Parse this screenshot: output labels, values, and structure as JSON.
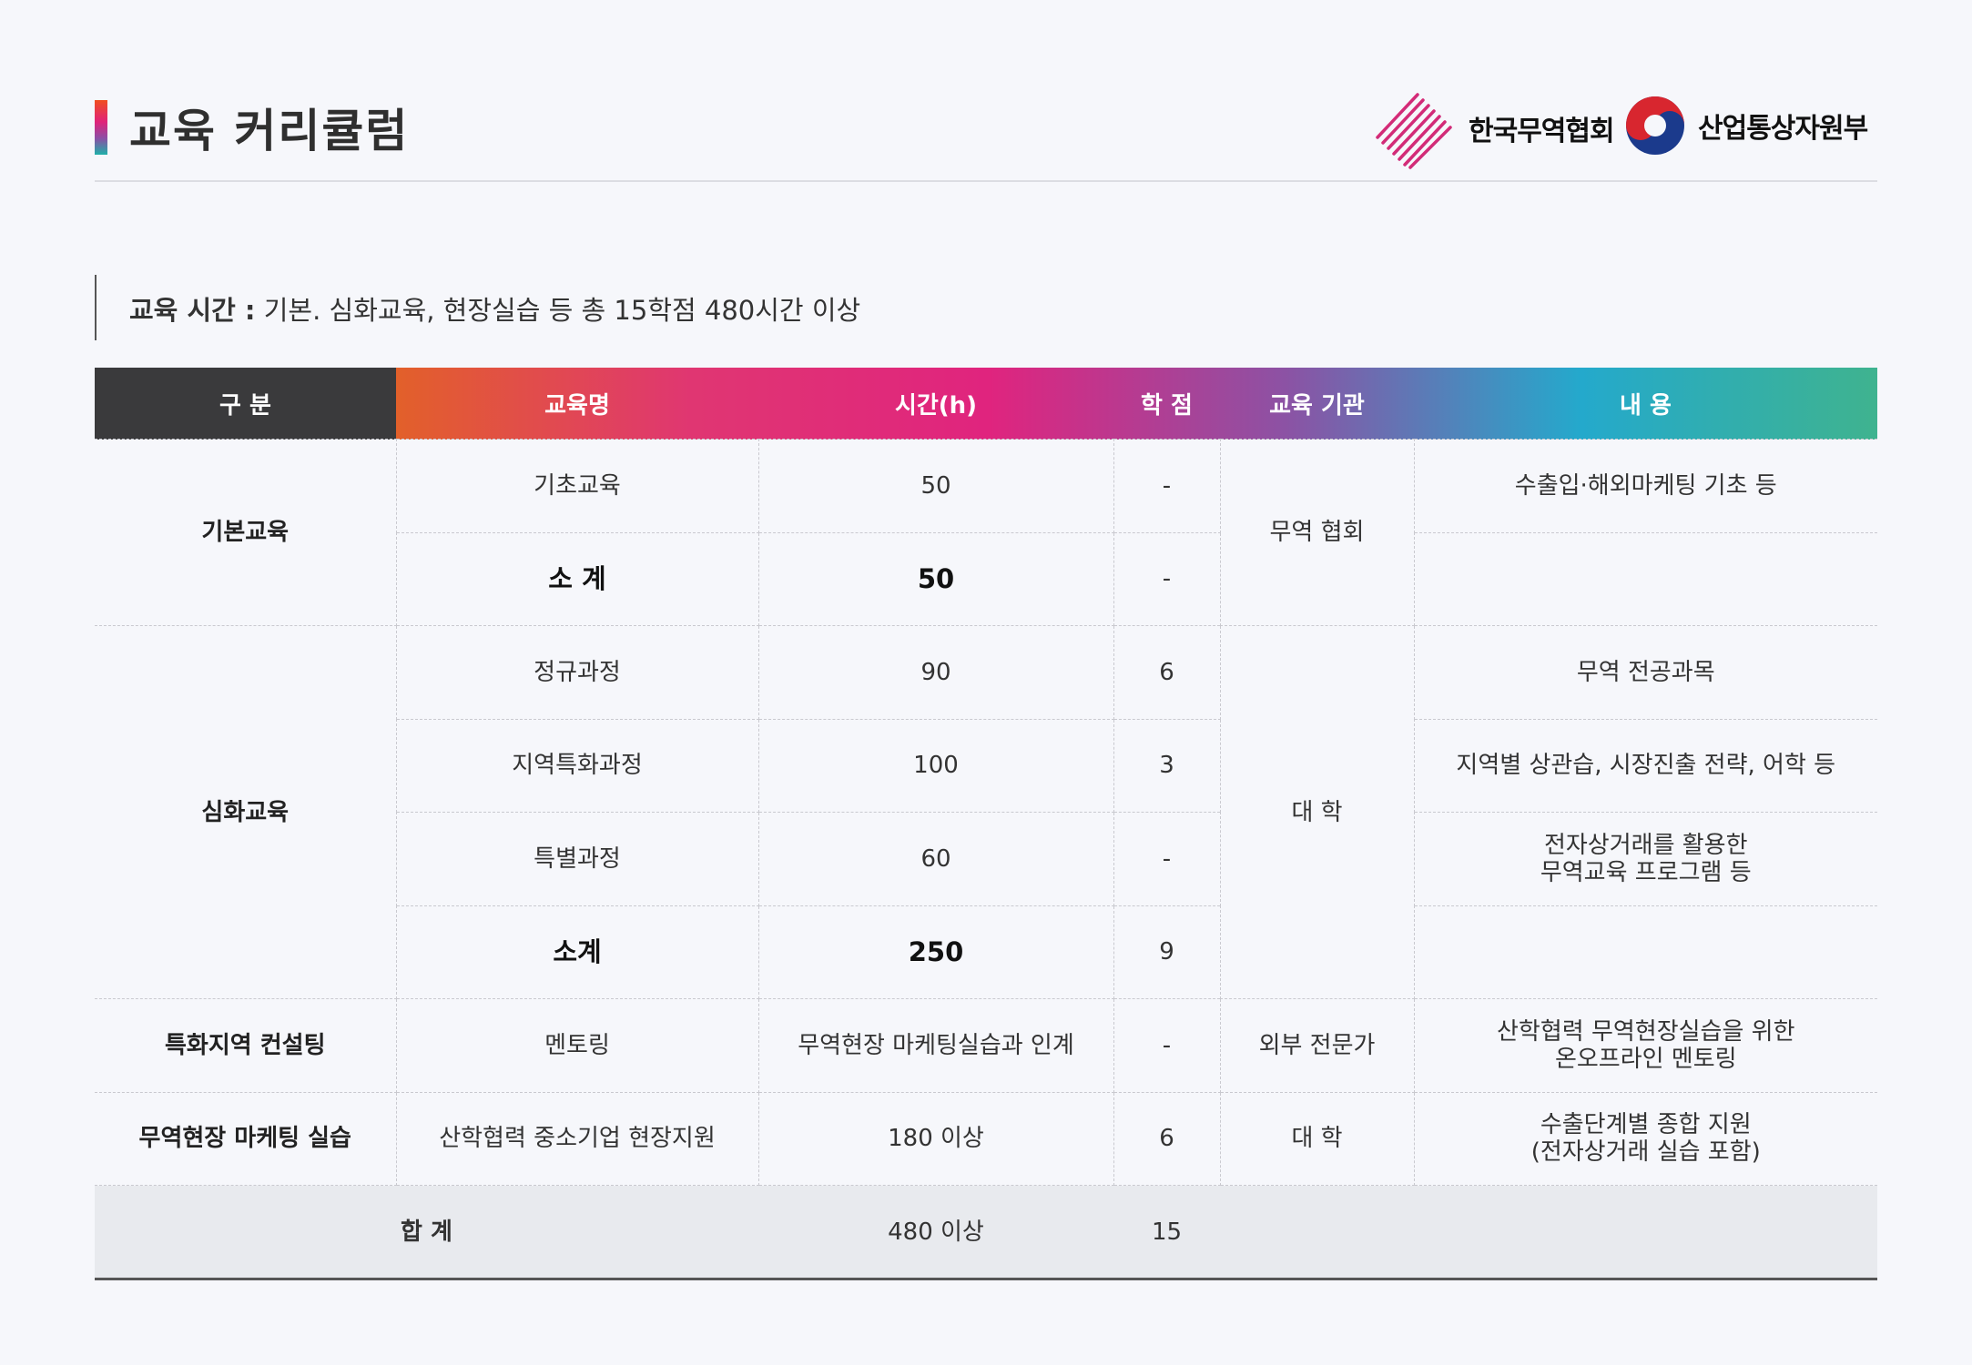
{
  "page": {
    "title": "교육 커리큘럼"
  },
  "logos": {
    "kita": "한국무역협회",
    "motie": "산업통상자원부"
  },
  "note": {
    "label": "교육 시간 :",
    "text": " 기본. 심화교육, 현장실습 등 총 15학점 480시간 이상"
  },
  "colors": {
    "header_gradient": [
      "#e2602a",
      "#e03672",
      "#e0247e",
      "#8c52a4",
      "#24a9cc",
      "#3fb38f"
    ]
  },
  "table": {
    "headers": [
      "구 분",
      "교육명",
      "시간(h)",
      "학 점",
      "교육 기관",
      "내 용"
    ],
    "rows": [
      {
        "category": "기본교육",
        "name": "기초교육",
        "hours": "50",
        "credit": "-",
        "inst": "무역 협회",
        "content": "수출입·해외마케팅 기초 등"
      },
      {
        "name": "소 계",
        "hours": "50",
        "credit": "-",
        "content": ""
      },
      {
        "category": "심화교육",
        "name": "정규과정",
        "hours": "90",
        "credit": "6",
        "inst": "대 학",
        "content": "무역 전공과목"
      },
      {
        "name": "지역특화과정",
        "hours": "100",
        "credit": "3",
        "content": "지역별 상관습, 시장진출 전략, 어학 등"
      },
      {
        "name": "특별과정",
        "hours": "60",
        "credit": "-",
        "content": "전자상거래를 활용한\n무역교육 프로그램 등"
      },
      {
        "name": "소계",
        "hours": "250",
        "credit": "9",
        "content": ""
      },
      {
        "category": "특화지역 컨설팅",
        "name": "멘토링",
        "hours": "무역현장 마케팅실습과 인계",
        "credit": "-",
        "inst": "외부 전문가",
        "content": "산학협력 무역현장실습을 위한\n온오프라인 멘토링"
      },
      {
        "category": "무역현장 마케팅 실습",
        "name": "산학협력 중소기업 현장지원",
        "hours": "180 이상",
        "credit": "6",
        "inst": "대 학",
        "content": "수출단계별 종합 지원\n(전자상거래 실습 포함)"
      }
    ],
    "total": {
      "label": "합 계",
      "hours": "480 이상",
      "credit": "15"
    }
  }
}
